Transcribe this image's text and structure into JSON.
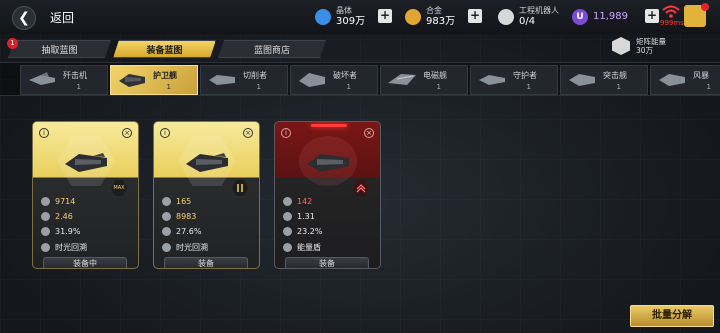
{
  "header": {
    "back_label": "返回",
    "resources": [
      {
        "label": "晶体",
        "value": "309万"
      },
      {
        "label": "合金",
        "value": "983万"
      },
      {
        "label": "工程机器人",
        "value": "0/4"
      },
      {
        "label": "",
        "value": "11,989"
      }
    ],
    "ping": "999ms",
    "colors": {
      "crystal": "#3a8ee6",
      "alloy": "#e0a630",
      "premium": "#7a4cd6",
      "ping": "#ff3838"
    }
  },
  "tabs": [
    {
      "label": "抽取蓝图",
      "active": false,
      "badge": "1"
    },
    {
      "label": "装备蓝图",
      "active": true
    },
    {
      "label": "蓝图商店",
      "active": false
    }
  ],
  "matrix_energy": {
    "label": "矩阵能量",
    "value": "30万"
  },
  "ships": [
    {
      "name": "歼击机",
      "count": "1",
      "icon": "fighter-icon"
    },
    {
      "name": "护卫舰",
      "count": "1",
      "icon": "frigate-icon",
      "active": true
    },
    {
      "name": "切削者",
      "count": "1",
      "icon": "cutter-icon"
    },
    {
      "name": "破坏者",
      "count": "1",
      "icon": "destroyer-icon"
    },
    {
      "name": "电磁舰",
      "count": "1",
      "icon": "em-ship-icon"
    },
    {
      "name": "守护者",
      "count": "1",
      "icon": "guardian-icon"
    },
    {
      "name": "突击舰",
      "count": "1",
      "icon": "assault-icon"
    },
    {
      "name": "风暴",
      "count": "1",
      "icon": "storm-icon"
    }
  ],
  "cards": [
    {
      "theme": "gold",
      "rank": "MAX",
      "stats": [
        "9714",
        "2.46",
        "31.9%"
      ],
      "skill": "时光回溯",
      "button": "装备中"
    },
    {
      "theme": "gold",
      "rank": "",
      "stats": [
        "165",
        "8983",
        "27.6%"
      ],
      "skill": "时光回溯",
      "button": "装备"
    },
    {
      "theme": "red",
      "rank": "",
      "stats": [
        "142",
        "1.31",
        "23.2%"
      ],
      "skill": "能量盾",
      "button": "装备"
    }
  ],
  "batch_button": "批量分解"
}
